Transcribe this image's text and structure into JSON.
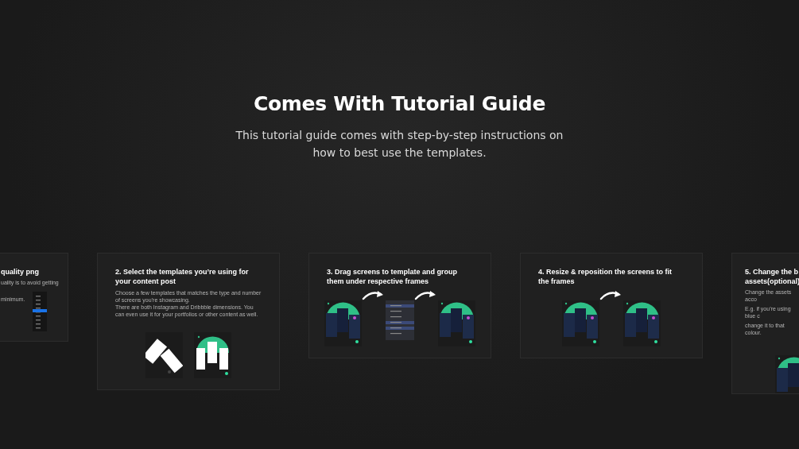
{
  "heading": {
    "title": "Comes With Tutorial Guide",
    "subtitle": "This tutorial guide comes with step-by-step instructions on how to best use the templates."
  },
  "cards": [
    {
      "kind": "side",
      "title": "quality png",
      "paragraphs": [
        "uality is to avoid getting",
        "minimum."
      ],
      "visuals": [
        {
          "kind": "menu"
        }
      ]
    },
    {
      "kind": "stack",
      "title": "2. Select the templates you’re using for your content post",
      "paragraphs": [
        "Choose a few templates that matches the type and number of screens you’re showcasing.",
        "There are both Instagram and Dribbble dimensions. You can even use it for your portfolios or other content as well."
      ],
      "visuals": [
        {
          "kind": "tilted"
        },
        {
          "kind": "arc"
        }
      ]
    },
    {
      "kind": "stack",
      "title": "3. Drag screens to template and group them under respective frames",
      "visuals": [
        {
          "kind": "mockup"
        },
        {
          "kind": "arrow"
        },
        {
          "kind": "layers"
        },
        {
          "kind": "arrow"
        },
        {
          "kind": "mockup"
        }
      ]
    },
    {
      "kind": "stack",
      "title": "4. Resize & reposition the screens to fit the frames",
      "visuals": [
        {
          "kind": "mockup"
        },
        {
          "kind": "arrow"
        },
        {
          "kind": "mockup"
        }
      ]
    },
    {
      "kind": "edge",
      "title_lines": [
        "5. Change the b",
        "assets(optional)"
      ],
      "paragraphs": [
        "Change the assets acco",
        "E.g. if you’re using blue c",
        "change it to that colour."
      ],
      "visuals": [
        {
          "kind": "mockup"
        }
      ]
    }
  ]
}
